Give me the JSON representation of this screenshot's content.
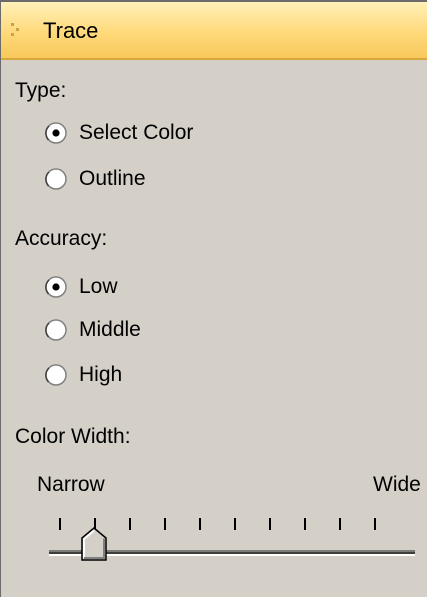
{
  "panel": {
    "title": "Trace"
  },
  "type_section": {
    "label": "Type:",
    "options": [
      {
        "label": "Select Color",
        "selected": true
      },
      {
        "label": "Outline",
        "selected": false
      }
    ]
  },
  "accuracy_section": {
    "label": "Accuracy:",
    "options": [
      {
        "label": "Low",
        "selected": true
      },
      {
        "label": "Middle",
        "selected": false
      },
      {
        "label": "High",
        "selected": false
      }
    ]
  },
  "color_width": {
    "label": "Color Width:",
    "min_label": "Narrow",
    "max_label": "Wide",
    "value_tick": 1,
    "tick_count": 10
  },
  "colors": {
    "titlebar_accent": "#ffd97a",
    "panel_background": "#d4d0c8"
  }
}
